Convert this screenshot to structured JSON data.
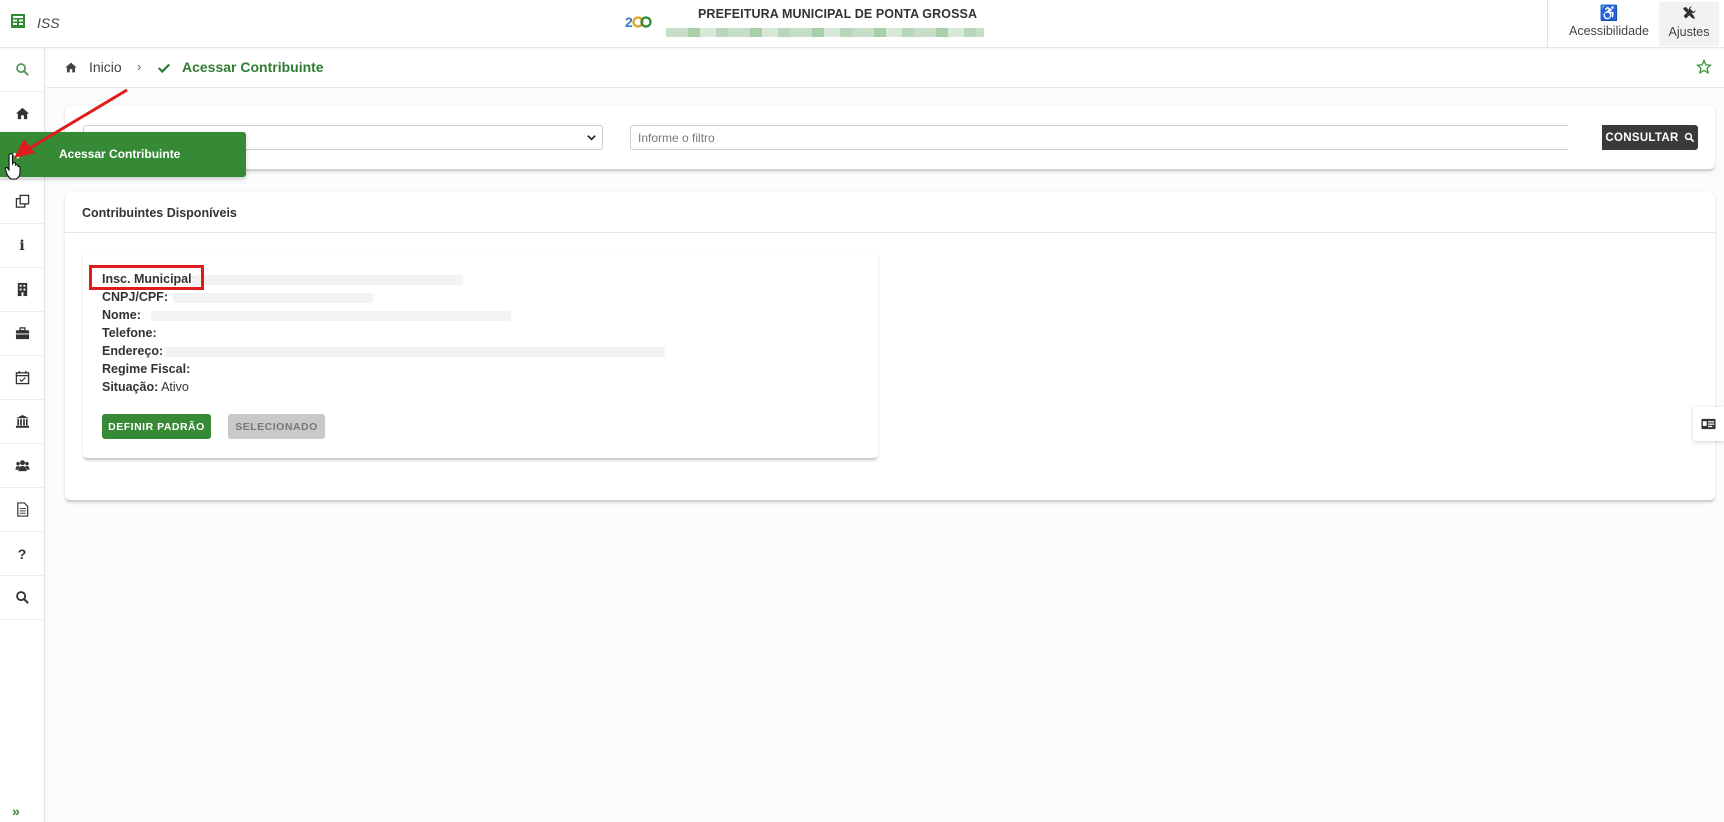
{
  "header": {
    "app_name": "ISS",
    "municipality": "PREFEITURA MUNICIPAL DE PONTA GROSSA",
    "accessibility_label": "Acessibilidade",
    "settings_label": "Ajustes"
  },
  "sidebar": {
    "items": [
      "search-icon",
      "home-icon",
      "check-icon",
      "clone-icon",
      "info-icon",
      "building-icon",
      "briefcase-icon",
      "calendar-check-icon",
      "bank-icon",
      "users-icon",
      "file-text-icon",
      "question-icon",
      "search-icon"
    ],
    "info_glyph": "i",
    "help_glyph": "?",
    "expand_glyph": "»"
  },
  "flyout": {
    "label": "Acessar Contribuinte"
  },
  "breadcrumb": {
    "home_label": "Inicio",
    "separator": "›",
    "current": "Acessar Contribuinte"
  },
  "filter": {
    "input_placeholder": "Informe o filtro",
    "input_value": "",
    "consultar_label": "CONSULTAR"
  },
  "contribuintes": {
    "title": "Contribuintes Disponíveis",
    "fields": {
      "insc_municipal_label": "Insc. Municipal:",
      "cnpj_label": "CNPJ/CPF:",
      "nome_label": "Nome:",
      "telefone_label": "Telefone:",
      "endereco_label": "Endereço:",
      "regime_label": "Regime Fiscal:",
      "situacao_label": "Situação:",
      "situacao_value": "Ativo"
    },
    "definir_label": "DEFINIR PADRÃO",
    "selecionado_label": "SELECIONADO"
  },
  "colors": {
    "primary_green": "#378a35",
    "highlight_red": "#e01b1b",
    "dark_button": "#3a3a3a"
  }
}
